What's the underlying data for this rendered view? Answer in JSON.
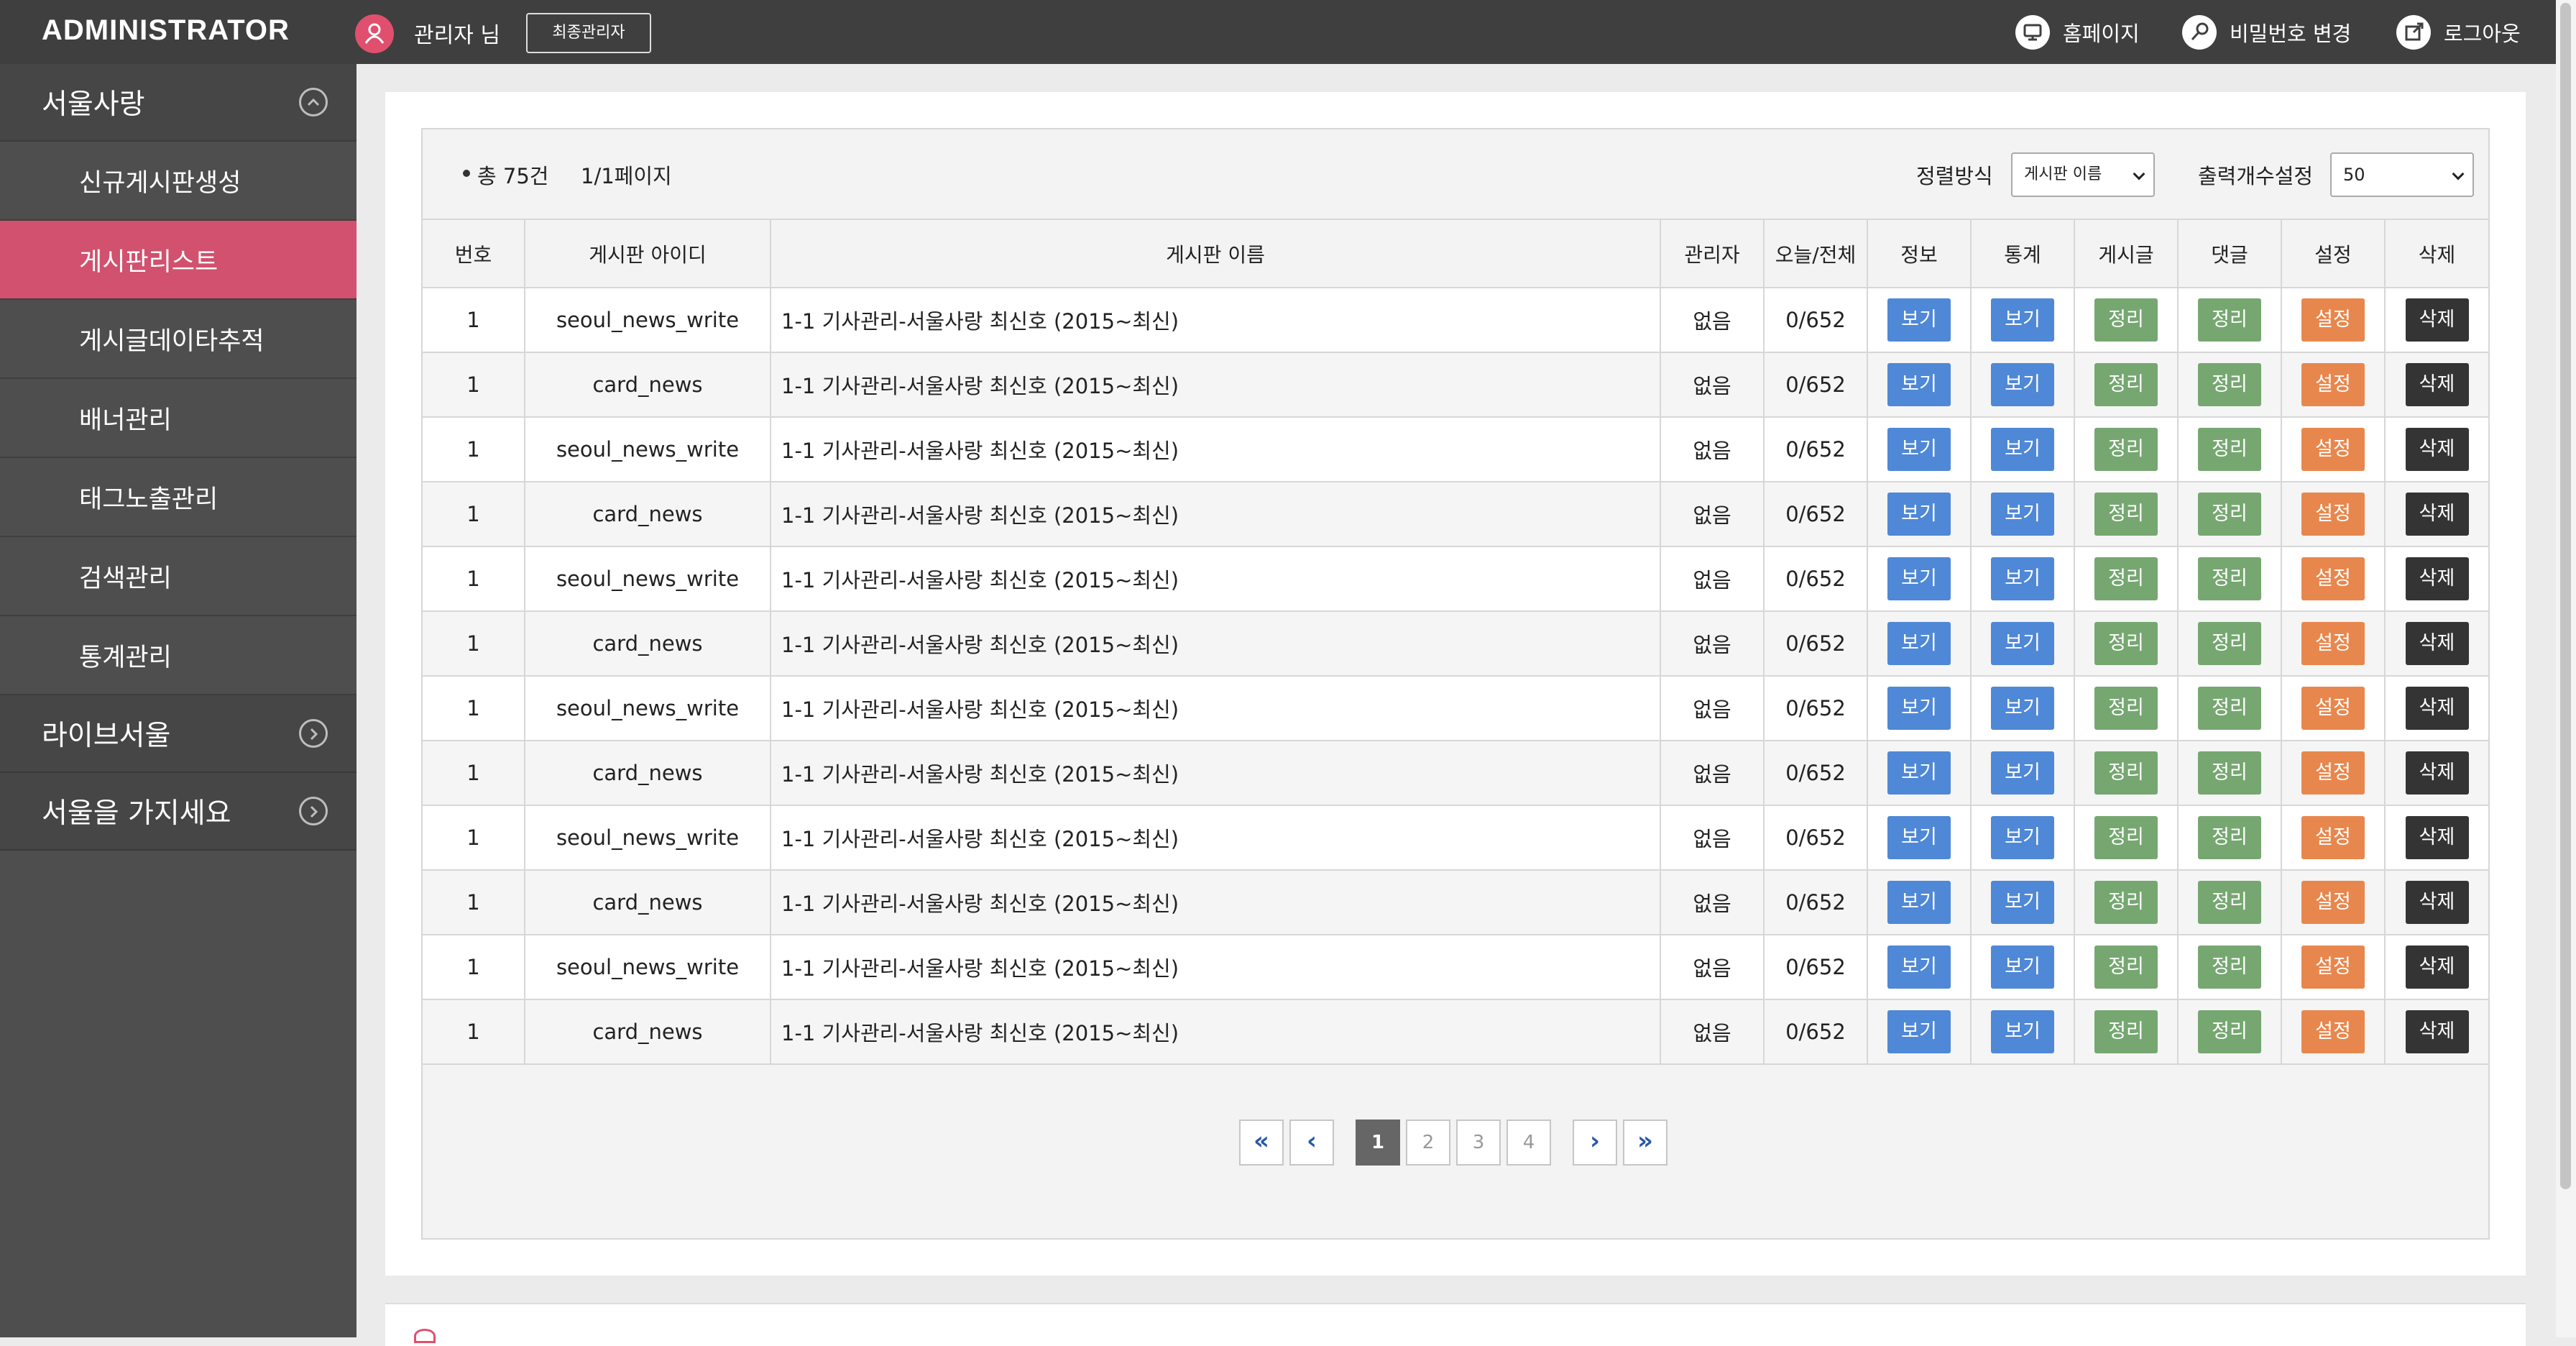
{
  "header": {
    "brand": "ADMINISTRATOR",
    "admin_name": "관리자 님",
    "super_admin_label": "최종관리자",
    "links": [
      {
        "label": "홈페이지",
        "icon": "monitor-icon"
      },
      {
        "label": "비밀번호 변경",
        "icon": "key-icon"
      },
      {
        "label": "로그아웃",
        "icon": "logout-icon"
      }
    ]
  },
  "sidebar": {
    "categories": [
      {
        "label": "서울사랑",
        "icon": "chevron-up-circle-icon",
        "expanded": true
      },
      {
        "label": "라이브서울",
        "icon": "chevron-right-circle-icon",
        "expanded": false
      },
      {
        "label": "서울을 가지세요",
        "icon": "chevron-right-circle-icon",
        "expanded": false
      }
    ],
    "items": [
      {
        "label": "신규게시판생성"
      },
      {
        "label": "게시판리스트",
        "active": true
      },
      {
        "label": "게시글데이타추적"
      },
      {
        "label": "배너관리"
      },
      {
        "label": "태그노출관리"
      },
      {
        "label": "검색관리"
      },
      {
        "label": "통계관리"
      }
    ]
  },
  "toolbar": {
    "total": "총 75건",
    "page_info": "1/1페이지",
    "sort_label": "정렬방식",
    "sort_value": "게시판 이름",
    "count_label": "출력개수설정",
    "count_value": "50"
  },
  "table": {
    "headers": [
      "번호",
      "게시판 아이디",
      "게시판 이름",
      "관리자",
      "오늘/전체",
      "정보",
      "통계",
      "게시글",
      "댓글",
      "설정",
      "삭제"
    ],
    "button_labels": {
      "info": "보기",
      "stats": "보기",
      "posts": "정리",
      "comments": "정리",
      "settings": "설정",
      "delete": "삭제"
    },
    "rows": [
      {
        "no": "1",
        "id": "seoul_news_write",
        "name": "1-1 기사관리-서울사랑 최신호 (2015~최신)",
        "manager": "없음",
        "count": "0/652"
      },
      {
        "no": "1",
        "id": "card_news",
        "name": "1-1 기사관리-서울사랑 최신호 (2015~최신)",
        "manager": "없음",
        "count": "0/652"
      },
      {
        "no": "1",
        "id": "seoul_news_write",
        "name": "1-1 기사관리-서울사랑 최신호 (2015~최신)",
        "manager": "없음",
        "count": "0/652"
      },
      {
        "no": "1",
        "id": "card_news",
        "name": "1-1 기사관리-서울사랑 최신호 (2015~최신)",
        "manager": "없음",
        "count": "0/652"
      },
      {
        "no": "1",
        "id": "seoul_news_write",
        "name": "1-1 기사관리-서울사랑 최신호 (2015~최신)",
        "manager": "없음",
        "count": "0/652"
      },
      {
        "no": "1",
        "id": "card_news",
        "name": "1-1 기사관리-서울사랑 최신호 (2015~최신)",
        "manager": "없음",
        "count": "0/652"
      },
      {
        "no": "1",
        "id": "seoul_news_write",
        "name": "1-1 기사관리-서울사랑 최신호 (2015~최신)",
        "manager": "없음",
        "count": "0/652"
      },
      {
        "no": "1",
        "id": "card_news",
        "name": "1-1 기사관리-서울사랑 최신호 (2015~최신)",
        "manager": "없음",
        "count": "0/652"
      },
      {
        "no": "1",
        "id": "seoul_news_write",
        "name": "1-1 기사관리-서울사랑 최신호 (2015~최신)",
        "manager": "없음",
        "count": "0/652"
      },
      {
        "no": "1",
        "id": "card_news",
        "name": "1-1 기사관리-서울사랑 최신호 (2015~최신)",
        "manager": "없음",
        "count": "0/652"
      },
      {
        "no": "1",
        "id": "seoul_news_write",
        "name": "1-1 기사관리-서울사랑 최신호 (2015~최신)",
        "manager": "없음",
        "count": "0/652"
      },
      {
        "no": "1",
        "id": "card_news",
        "name": "1-1 기사관리-서울사랑 최신호 (2015~최신)",
        "manager": "없음",
        "count": "0/652"
      }
    ]
  },
  "pagination": {
    "first": "«",
    "prev": "‹",
    "pages": [
      "1",
      "2",
      "3",
      "4"
    ],
    "current": "1",
    "next": "›",
    "last": "»"
  },
  "colors": {
    "topbar": "#3f3f3f",
    "sidebar": "#4e4e4e",
    "accent": "#d1516e",
    "btn_blue": "#4f88d6",
    "btn_green": "#76a771",
    "btn_orange": "#e8874d",
    "btn_dark": "#343434"
  }
}
